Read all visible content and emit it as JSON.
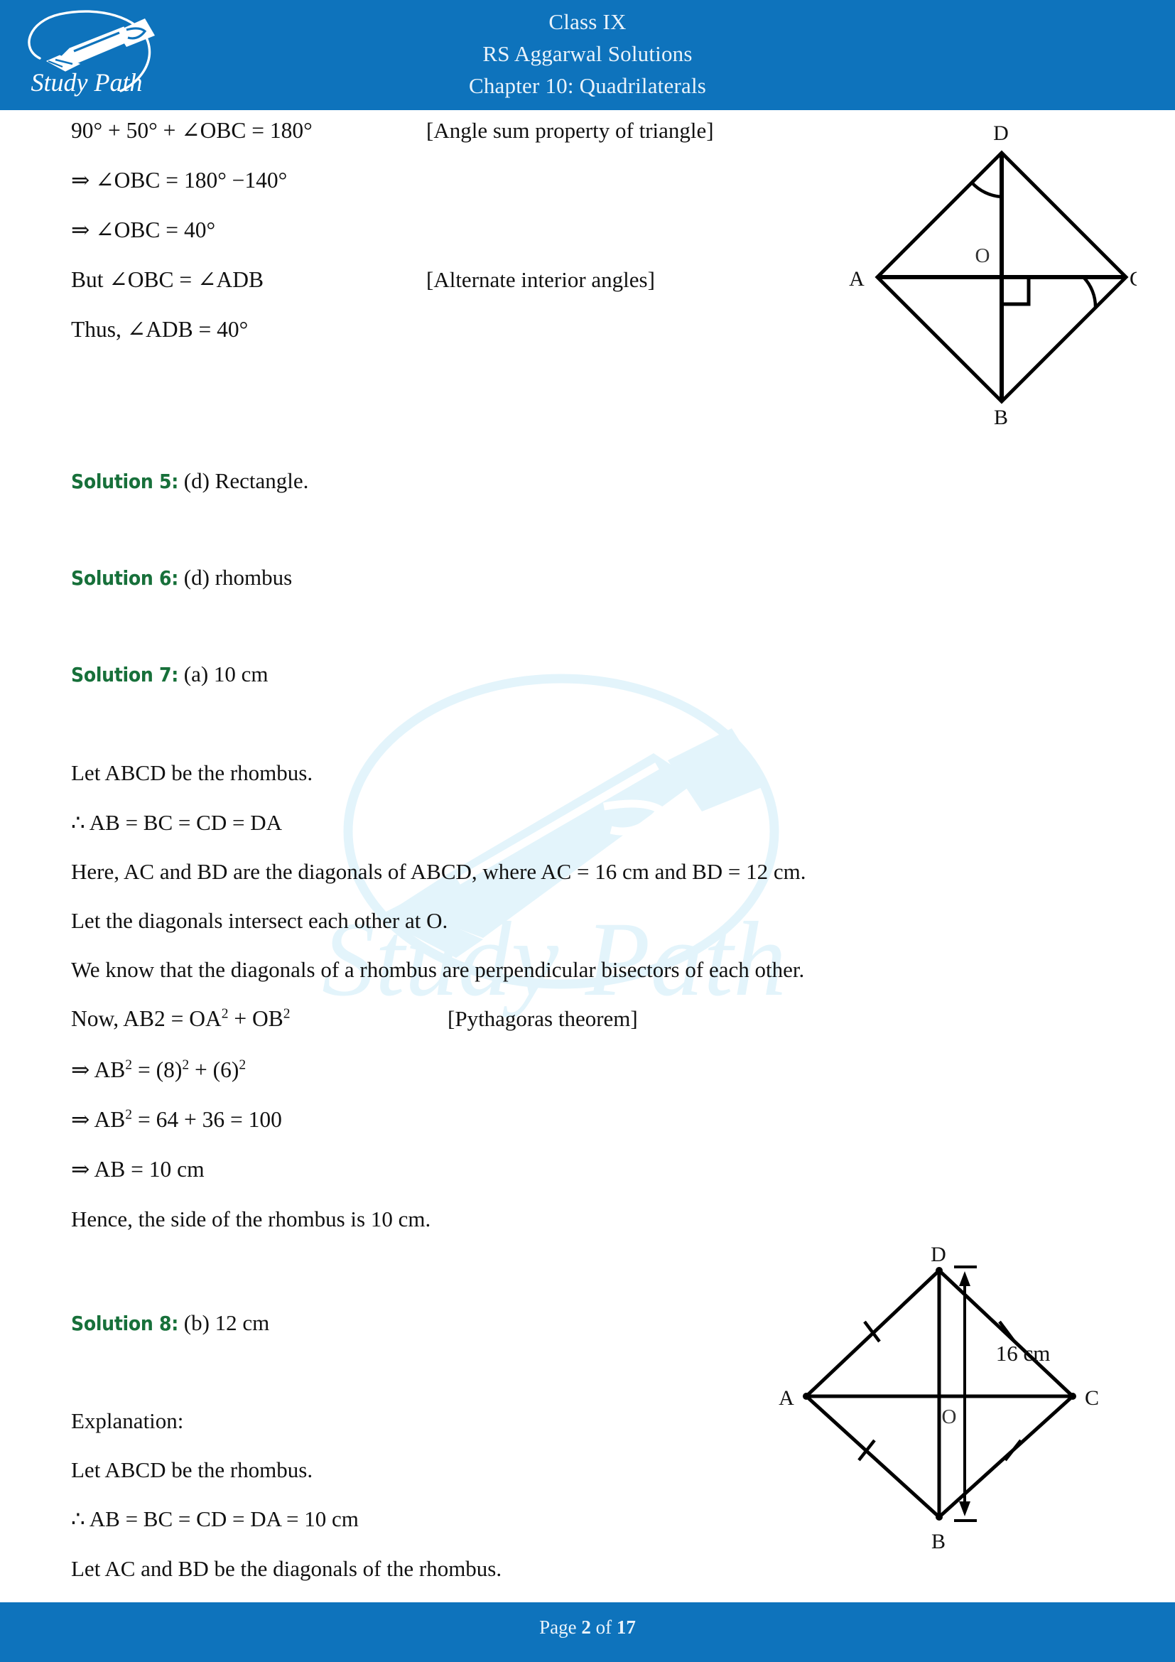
{
  "header": {
    "logo_name": "study-path-logo",
    "logo_text": "Study Path",
    "line1": "Class IX",
    "line2": "RS Aggarwal Solutions",
    "line3": "Chapter 10: Quadrilaterals",
    "bg_color": "#0e73bc",
    "text_color": "#e9f3fb"
  },
  "footer": {
    "prefix": "Page ",
    "current_page": "2",
    "middle": " of ",
    "total_pages": "17",
    "bg_color": "#0e73bc",
    "text_color": "#e9f3fb"
  },
  "watermark": {
    "text": "Study Path",
    "color": "#e3f4fb"
  },
  "colors": {
    "solution_label": "#17703a",
    "body_text": "#111111",
    "brand_blue": "#0e73bc"
  },
  "body": {
    "eq1": "90° + 50° + ∠OBC = 180°",
    "eq1_note": "[Angle sum property of triangle]",
    "eq2": "⇒ ∠OBC = 180° −140°",
    "eq3": "⇒ ∠OBC = 40°",
    "eq4": "But ∠OBC = ∠ADB",
    "eq4_note": "[Alternate interior angles]",
    "eq5": "Thus, ∠ADB = 40°",
    "sol5_label": "Solution 5:",
    "sol5_text": "(d) Rectangle.",
    "sol6_label": "Solution 6:",
    "sol6_text": "(d) rhombus",
    "sol7_label": "Solution 7:",
    "sol7_text": "(a) 10 cm",
    "p1": "Let ABCD be the rhombus.",
    "p2": "∴ AB = BC = CD = DA",
    "p3": "Here, AC and BD are the diagonals of ABCD, where AC = 16 cm and BD = 12 cm.",
    "p4": "Let the diagonals intersect each other at O.",
    "p5": "We know that the diagonals of a rhombus are perpendicular bisectors of each other.",
    "p6_a": "Now, AB2  =  OA",
    "p6_sup1": "2",
    "p6_b": " + OB",
    "p6_sup2": "2",
    "p6_note": "[Pythagoras theorem]",
    "p7_a": "⇒  AB",
    "p7_sup1": "2",
    "p7_b": " = (8)",
    "p7_sup2": "2",
    "p7_c": " + (6)",
    "p7_sup3": "2",
    "p8_a": "⇒ AB",
    "p8_sup1": "2",
    "p8_b": " = 64 + 36 = 100",
    "p9": "⇒ AB = 10 cm",
    "p10": "Hence, the side of the rhombus is 10 cm.",
    "sol8_label": "Solution 8:",
    "sol8_text": "(b) 12 cm",
    "p11": "Explanation:",
    "p12": "Let ABCD be the rhombus.",
    "p13": "∴ AB = BC = CD = DA = 10 cm",
    "p14": "Let AC and BD be the diagonals of the rhombus."
  },
  "diagram1": {
    "name": "rhombus-abcd-with-right-angle-mark",
    "vertex_a": "A",
    "vertex_b": "B",
    "vertex_c": "C",
    "vertex_d": "D",
    "center": "O"
  },
  "diagram2": {
    "name": "rhombus-abcd-with-16cm-diagonal",
    "vertex_a": "A",
    "vertex_b": "B",
    "vertex_c": "C",
    "vertex_d": "D",
    "center": "O",
    "dimension_label": "16 cm"
  }
}
